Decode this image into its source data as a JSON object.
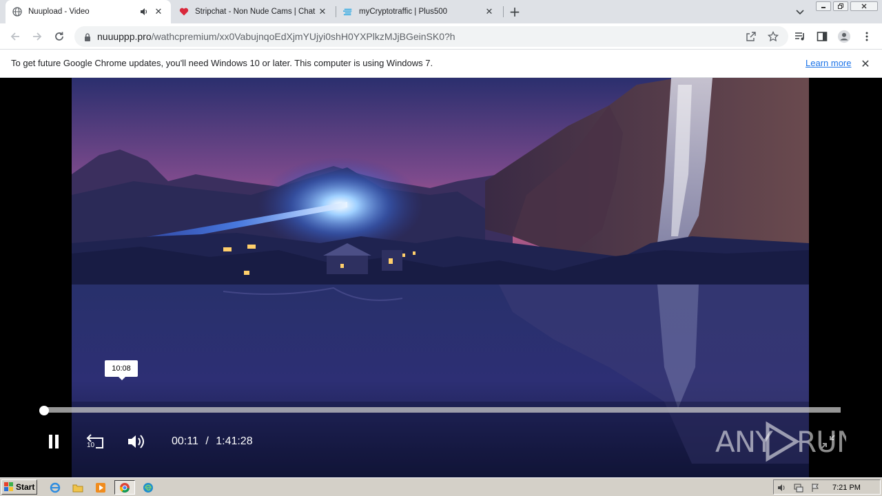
{
  "browser": {
    "tabs": [
      {
        "title": "Nuupload - Video",
        "favicon": "globe-icon",
        "active": true,
        "audio": true
      },
      {
        "title": "Stripchat - Non Nude Cams | Chat with",
        "favicon": "heart-icon",
        "active": false
      },
      {
        "title": "myCryptotraffic | Plus500",
        "favicon": "plus500-icon",
        "active": false
      }
    ],
    "url_host": "nuuuppp.pro",
    "url_path": "/wathcpremium/xx0VabujnqoEdXjmYUjyi0shH0YXPlkzMJjBGeinSK0?h"
  },
  "infobar": {
    "message": "To get future Google Chrome updates, you'll need Windows 10 or later. This computer is using Windows 7.",
    "link": "Learn more"
  },
  "player": {
    "hover_time": "10:08",
    "current_time": "00:11",
    "separator": "/",
    "duration": "1:41:28",
    "progress_fraction": 0.0018,
    "rewind_label": "10"
  },
  "watermark": "ANY RUN",
  "taskbar": {
    "start_label": "Start",
    "clock": "7:21 PM"
  },
  "colors": {
    "tabstrip": "#dee1e6",
    "link": "#1a73e8",
    "taskbar": "#d4d0c8"
  }
}
